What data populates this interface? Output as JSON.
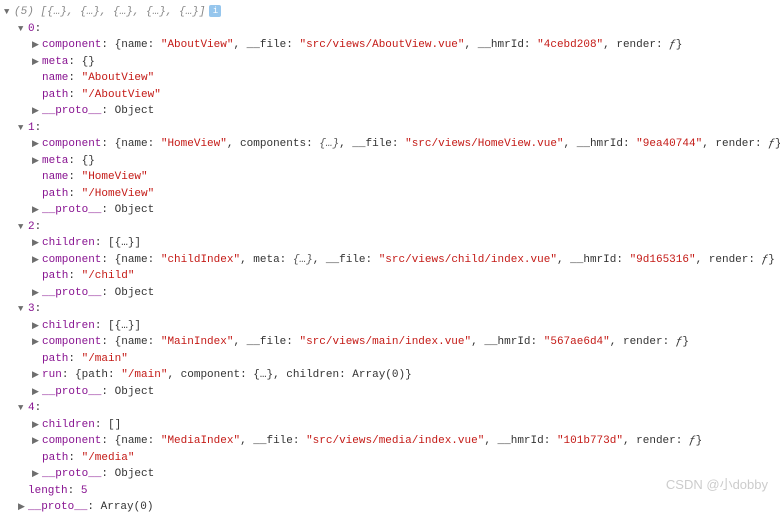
{
  "header": {
    "count": "(5)",
    "preview": "[{…}, {…}, {…}, {…}, {…}]",
    "info": "i"
  },
  "items": [
    {
      "idx": "0",
      "component": {
        "name": "AboutView",
        "file": "src/views/AboutView.vue",
        "hmrId": "4cebd208",
        "hasComponents": false,
        "hasMeta": false
      },
      "meta": "{}",
      "name": "AboutView",
      "path": "/AboutView",
      "proto": "Object"
    },
    {
      "idx": "1",
      "component": {
        "name": "HomeView",
        "file": "src/views/HomeView.vue",
        "hmrId": "9ea40744",
        "hasComponents": true,
        "hasMeta": false
      },
      "meta": "{}",
      "name": "HomeView",
      "path": "/HomeView",
      "proto": "Object"
    },
    {
      "idx": "2",
      "children": "[{…}]",
      "component": {
        "name": "childIndex",
        "file": "src/views/child/index.vue",
        "hmrId": "9d165316",
        "hasComponents": false,
        "hasMeta": true
      },
      "path": "/child",
      "proto": "Object"
    },
    {
      "idx": "3",
      "children": "[{…}]",
      "component": {
        "name": "MainIndex",
        "file": "src/views/main/index.vue",
        "hmrId": "567ae6d4",
        "hasComponents": false,
        "hasMeta": false
      },
      "path": "/main",
      "run": {
        "path": "/main",
        "tail": ", component: {…}, children: Array(0)}"
      },
      "proto": "Object"
    },
    {
      "idx": "4",
      "children": "[]",
      "component": {
        "name": "MediaIndex",
        "file": "src/views/media/index.vue",
        "hmrId": "101b773d",
        "hasComponents": false,
        "hasMeta": false
      },
      "path": "/media",
      "proto": "Object"
    }
  ],
  "length": "5",
  "protoTail": "Array(0)",
  "labels": {
    "component": "component",
    "meta": "meta",
    "name": "name",
    "path": "path",
    "children": "children",
    "run": "run",
    "proto": "__proto__",
    "length": "length",
    "nameK": "name",
    "fileK": "__file",
    "hmrK": "__hmrId",
    "renderK": "render",
    "componentsK": "components",
    "metaK": "meta",
    "fSym": "ƒ",
    "pathK": "path"
  },
  "watermark": "CSDN @小dobby"
}
